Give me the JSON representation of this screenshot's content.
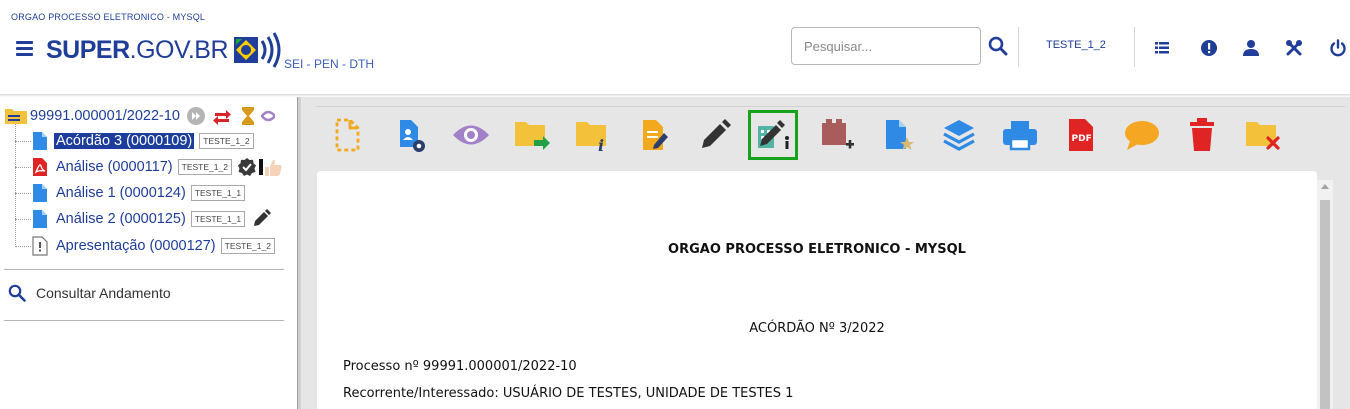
{
  "header": {
    "org_name": "ORGAO PROCESSO ELETRONICO - MYSQL",
    "logo_text_bold": "SUPER",
    "logo_text_rest": ".GOV.BR",
    "subsystem": "SEI - PEN - DTH",
    "search_placeholder": "Pesquisar...",
    "unit_label": "TESTE_1_2",
    "icons": [
      "menu-icon",
      "search-icon",
      "list-icon",
      "alert-icon",
      "user-icon",
      "tools-icon",
      "power-icon"
    ]
  },
  "tree": {
    "process": "99991.000001/2022-10",
    "documents": [
      {
        "label": "Acórdão 3 (0000109)",
        "tag": "TESTE_1_2",
        "icon": "document-icon",
        "selected": true
      },
      {
        "label": "Análise (0000117)",
        "tag": "TESTE_1_2",
        "icon": "pdf-icon",
        "selected": false
      },
      {
        "label": "Análise 1 (0000124)",
        "tag": "TESTE_1_1",
        "icon": "document-icon",
        "selected": false
      },
      {
        "label": "Análise 2 (0000125)",
        "tag": "TESTE_1_1",
        "icon": "document-icon",
        "selected": false
      },
      {
        "label": "Apresentação (0000127)",
        "tag": "TESTE_1_2",
        "icon": "external-document-icon",
        "selected": false
      }
    ],
    "consult": "Consultar Andamento"
  },
  "toolbar": {
    "buttons": [
      "new-document",
      "document-settings",
      "view",
      "send-process",
      "process-info",
      "edit-document",
      "sign",
      "sign-with-block",
      "add-to-block",
      "favorite-model",
      "layers",
      "print",
      "generate-pdf",
      "comment",
      "delete",
      "remove-folder"
    ],
    "active": "sign-with-block",
    "colors": {
      "active_border": "#17a21c",
      "brand_blue": "#1f3d99"
    }
  },
  "document": {
    "title": "ORGAO PROCESSO ELETRONICO - MYSQL",
    "subtitle": "ACÓRDÃO Nº 3/2022",
    "lines": [
      "Processo nº 99991.000001/2022-10",
      "Recorrente/Interessado: USUÁRIO DE TESTES, UNIDADE DE TESTES 1"
    ]
  }
}
